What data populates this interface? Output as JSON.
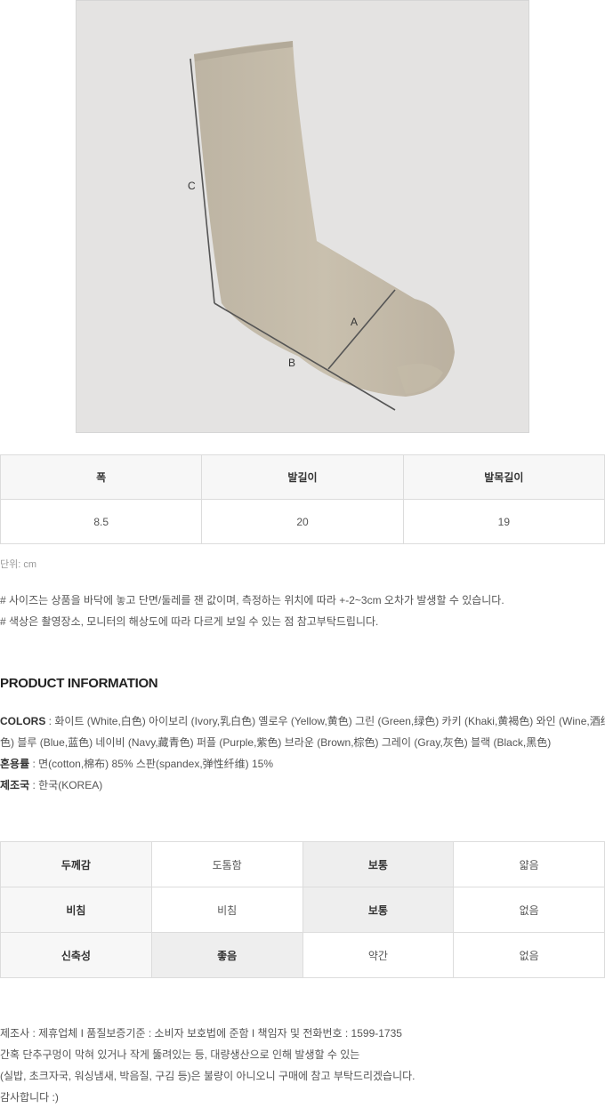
{
  "photo": {
    "measure_labels": {
      "a": "A",
      "b": "B",
      "c": "C"
    }
  },
  "size_table": {
    "headers": [
      "폭",
      "발길이",
      "발목길이"
    ],
    "values": [
      "8.5",
      "20",
      "19"
    ]
  },
  "unit_note": "단위: cm",
  "notes": [
    "# 사이즈는 상품을 바닥에 놓고 단면/둘레를 잰 값이며, 측정하는 위치에 따라 +-2~3cm 오차가 발생할 수 있습니다.",
    "# 색상은 촬영장소, 모니터의 해상도에 따라 다르게 보일 수 있는 점 참고부탁드립니다."
  ],
  "product_info": {
    "title": "PRODUCT INFORMATION",
    "colors_label": "COLORS",
    "colors_line1": " : 화이트 (White,白色) 아이보리 (Ivory,乳白色) 옐로우 (Yellow,黄色) 그린 (Green,绿色) 카키 (Khaki,黄褐色) 와인 (Wine,酒红",
    "colors_line2": "色) 블루 (Blue,蓝色) 네이비 (Navy,藏青色) 퍼플 (Purple,紫色) 브라운 (Brown,棕色) 그레이 (Gray,灰色) 블랙 (Black,黑色)",
    "material_label": "혼용률",
    "material_value": " : 면(cotton,棉布) 85% 스판(spandex,弹性纤维) 15%",
    "origin_label": "제조국",
    "origin_value": " : 한국(KOREA)"
  },
  "feel_table": {
    "rows": [
      {
        "label": "두께감",
        "options": [
          "도톰함",
          "보통",
          "얇음"
        ],
        "active": 1
      },
      {
        "label": "비침",
        "options": [
          "비침",
          "보통",
          "없음"
        ],
        "active": 1
      },
      {
        "label": "신축성",
        "options": [
          "좋음",
          "약간",
          "없음"
        ],
        "active": 0
      }
    ]
  },
  "footer": [
    "제조사 : 제휴업체 I 품질보증기준 : 소비자 보호법에 준함 I 책임자 및 전화번호 : 1599-1735",
    "간혹 단추구멍이 막혀 있거나 작게 뚫려있는 등, 대량생산으로 인해 발생할 수 있는",
    "(실밥, 초크자국, 워싱냄새, 박음질, 구김 등)은 불량이 아니오니 구매에 참고 부탁드리겠습니다.",
    "감사합니다 :)"
  ]
}
